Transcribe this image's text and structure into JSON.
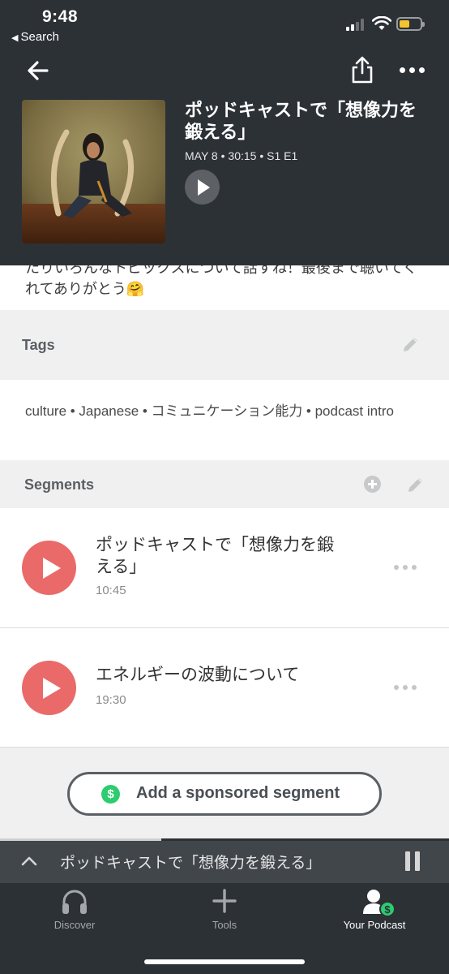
{
  "status_bar": {
    "time": "9:48",
    "back_app": "Search"
  },
  "episode": {
    "title": "ポッドキャストで「想像力を鍛える」",
    "meta": "MAY 8 • 30:15 • S1 E1"
  },
  "description": {
    "text_partial": "たりいろんなトピックスについて話すね！最後まで聴いてくれてありがとう🤗"
  },
  "tags": {
    "header": "Tags",
    "text": "culture • Japanese • コミュニケーション能力 • podcast intro"
  },
  "segments": {
    "header": "Segments",
    "items": [
      {
        "title": "ポッドキャストで「想像力を鍛える」",
        "time": "10:45"
      },
      {
        "title": "エネルギーの波動について",
        "time": "19:30"
      }
    ],
    "sponsor_button": "Add a sponsored segment",
    "sponsor_icon": "$"
  },
  "mini_player": {
    "title": "ポッドキャストで「想像力を鍛える」",
    "progress": 0.36
  },
  "tabbar": {
    "items": [
      {
        "label": "Discover",
        "icon": "headphones-icon"
      },
      {
        "label": "Tools",
        "icon": "plus-icon"
      },
      {
        "label": "Your Podcast",
        "icon": "user-dollar-icon"
      }
    ]
  },
  "colors": {
    "header_bg": "#2c3136",
    "play_red": "#ea6a6a",
    "sponsor_green": "#2ecc71",
    "battery_yellow": "#f4c430"
  }
}
